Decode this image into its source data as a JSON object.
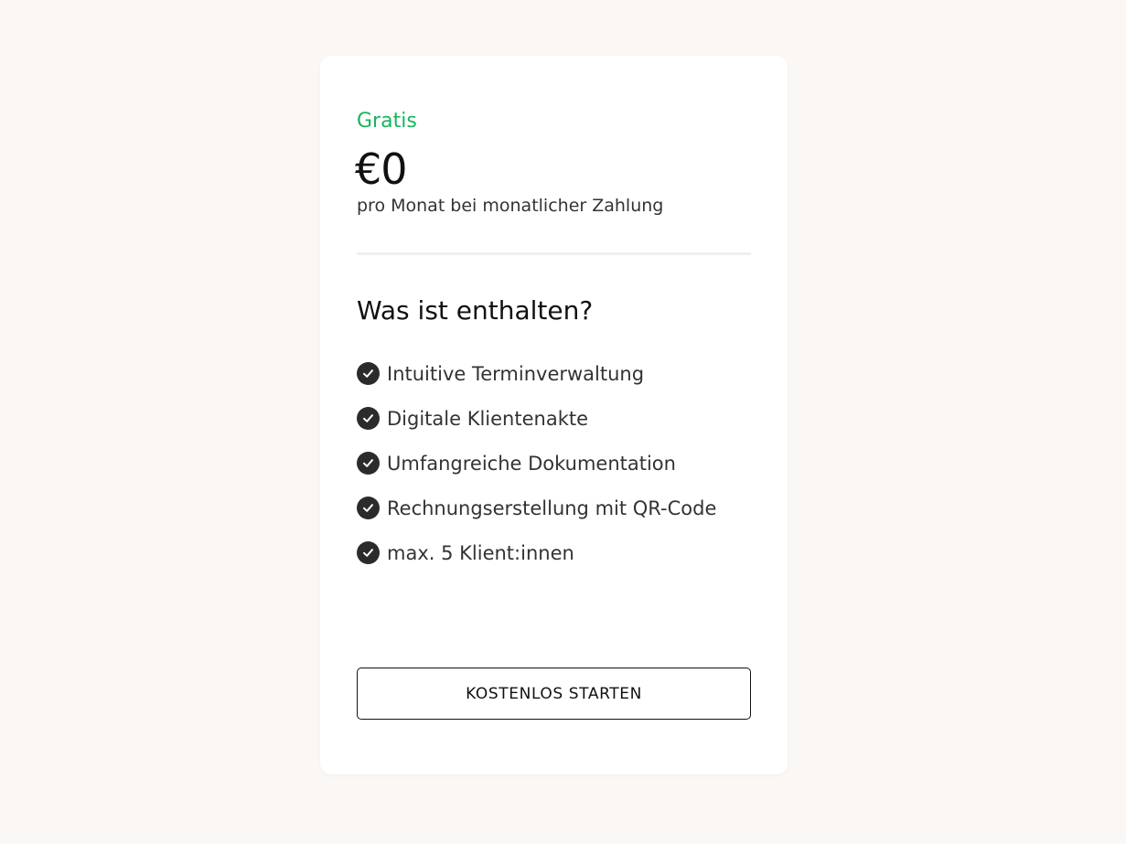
{
  "plan": {
    "name": "Gratis",
    "price": "€0",
    "price_note": "pro Monat bei monatlicher Zahlung"
  },
  "features": {
    "heading": "Was ist enthalten?",
    "items": [
      {
        "label": "Intuitive Terminverwaltung",
        "icon": "check-circle-icon"
      },
      {
        "label": "Digitale Klientenakte",
        "icon": "check-circle-icon"
      },
      {
        "label": "Umfangreiche Dokumentation",
        "icon": "check-circle-icon"
      },
      {
        "label": "Rechnungserstellung mit QR-Code",
        "icon": "check-circle-icon"
      },
      {
        "label": "max. 5 Klient:innen",
        "icon": "check-circle-icon"
      }
    ]
  },
  "cta": {
    "label": "KOSTENLOS STARTEN"
  },
  "colors": {
    "accent": "#16b55c",
    "page_background": "#fbf7f4",
    "card_background": "#ffffff",
    "text": "#111111",
    "icon": "#2b2b2b"
  }
}
